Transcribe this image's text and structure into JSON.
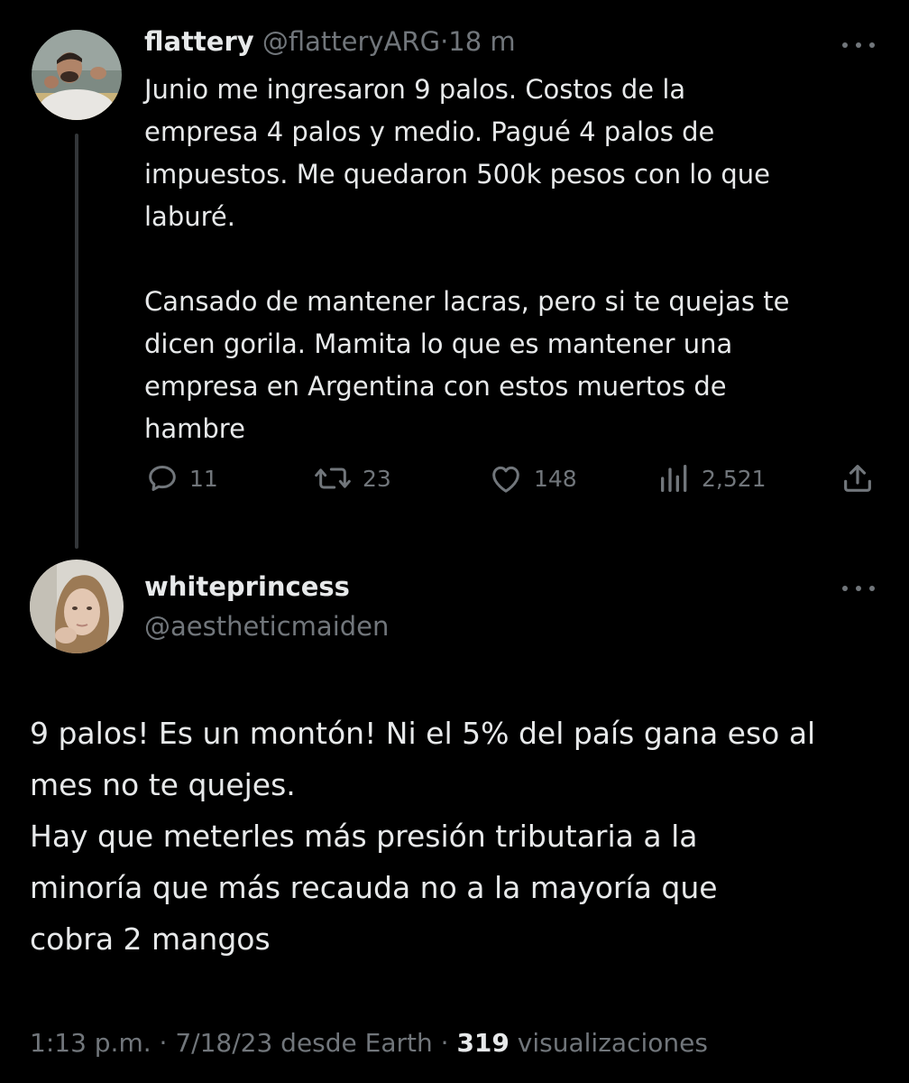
{
  "tweet1": {
    "display_name": "flattery",
    "handle": "@flatteryARG",
    "separator": "·",
    "time": "18 m",
    "text": "Junio me ingresaron 9 palos. Costos de la\nempresa 4 palos y medio. Pagué 4 palos de\nimpuestos. Me quedaron 500k pesos con lo que\nlaburé.\n\nCansado de mantener lacras, pero si te quejas te\ndicen gorila. Mamita lo que es mantener una\nempresa en Argentina con estos muertos de\nhambre",
    "actions": {
      "replies": "11",
      "retweets": "23",
      "likes": "148",
      "views": "2,521"
    }
  },
  "tweet2": {
    "display_name": "whiteprincess",
    "handle": "@aestheticmaiden",
    "text": "9 palos! Es un montón! Ni el 5% del país gana eso al\nmes no te quejes.\nHay que meterles más presión tributaria a la\nminoría que más recauda no a la mayoría que\ncobra 2 mangos",
    "footer": {
      "meta": "1:13 p.m. · 7/18/23 desde Earth · ",
      "views_count": "319",
      "views_label": " visualizaciones"
    }
  },
  "icons": {
    "reply": "reply-bubble-icon",
    "retweet": "retweet-arrows-icon",
    "like": "heart-icon",
    "views": "bar-chart-icon",
    "share": "share-upload-icon",
    "more": "more-dots-icon"
  },
  "colors": {
    "background": "#000000",
    "text_primary": "#e7e9ea",
    "text_secondary": "#71767b",
    "thread_line": "#333639"
  }
}
